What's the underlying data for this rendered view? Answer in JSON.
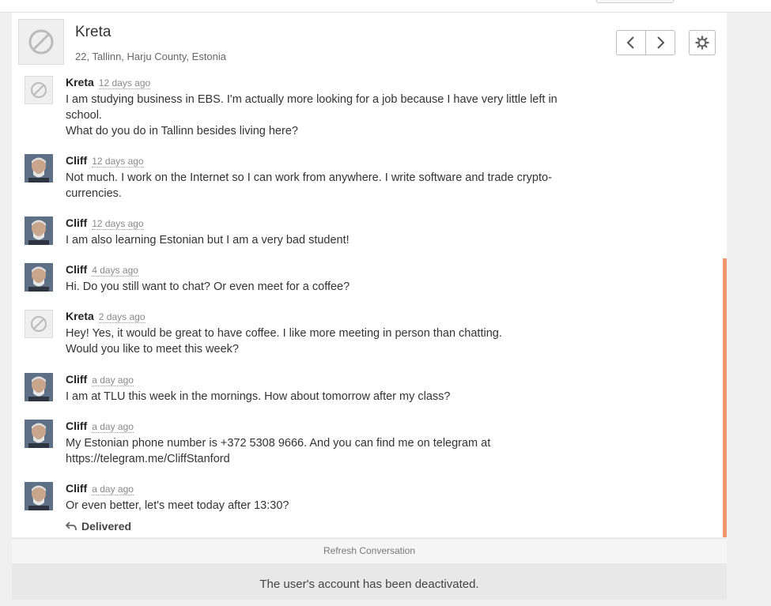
{
  "header": {
    "name": "Kreta",
    "location": "22, Tallinn, Harju County, Estonia"
  },
  "icons": {
    "default_avatar": "no-photo-icon",
    "prev": "chevron-left-icon",
    "next": "chevron-right-icon",
    "settings": "gear-icon",
    "reply": "reply-icon"
  },
  "messages": [
    {
      "author": "Kreta",
      "time": "12 days ago",
      "avatar": "default",
      "lines": [
        "I am studying business in EBS. I'm actually more looking for a job because I have very little left in school.",
        "What do you do in Tallinn besides living here?"
      ]
    },
    {
      "author": "Cliff",
      "time": "12 days ago",
      "avatar": "photo",
      "lines": [
        "Not much. I work on the Internet so I can work from anywhere. I write software and trade crypto-currencies."
      ]
    },
    {
      "author": "Cliff",
      "time": "12 days ago",
      "avatar": "photo",
      "lines": [
        "I am also learning Estonian but I am a very bad student!"
      ]
    },
    {
      "author": "Cliff",
      "time": "4 days ago",
      "avatar": "photo",
      "lines": [
        "Hi. Do you still want to chat? Or even meet for a coffee?"
      ]
    },
    {
      "author": "Kreta",
      "time": "2 days ago",
      "avatar": "default",
      "lines": [
        "Hey! Yes, it would be great to have coffee. I like more meeting in person than chatting.",
        "Would you like to meet this week?"
      ]
    },
    {
      "author": "Cliff",
      "time": "a day ago",
      "avatar": "photo",
      "lines": [
        "I am at TLU this week in the mornings. How about tomorrow after my class?"
      ]
    },
    {
      "author": "Cliff",
      "time": "a day ago",
      "avatar": "photo",
      "lines": [
        "My Estonian phone number is +372 5308 9666. And you can find me on telegram at https://telegram.me/CliffStanford"
      ]
    },
    {
      "author": "Cliff",
      "time": "a day ago",
      "avatar": "photo",
      "lines": [
        "Or even better, let's meet today after 13:30?"
      ]
    }
  ],
  "status": {
    "delivered": "Delivered"
  },
  "refresh_label": "Refresh Conversation",
  "notice": "The user's account has been deactivated.",
  "colors": {
    "scrollbar": "#f0966b",
    "background": "#f0f0f0"
  }
}
